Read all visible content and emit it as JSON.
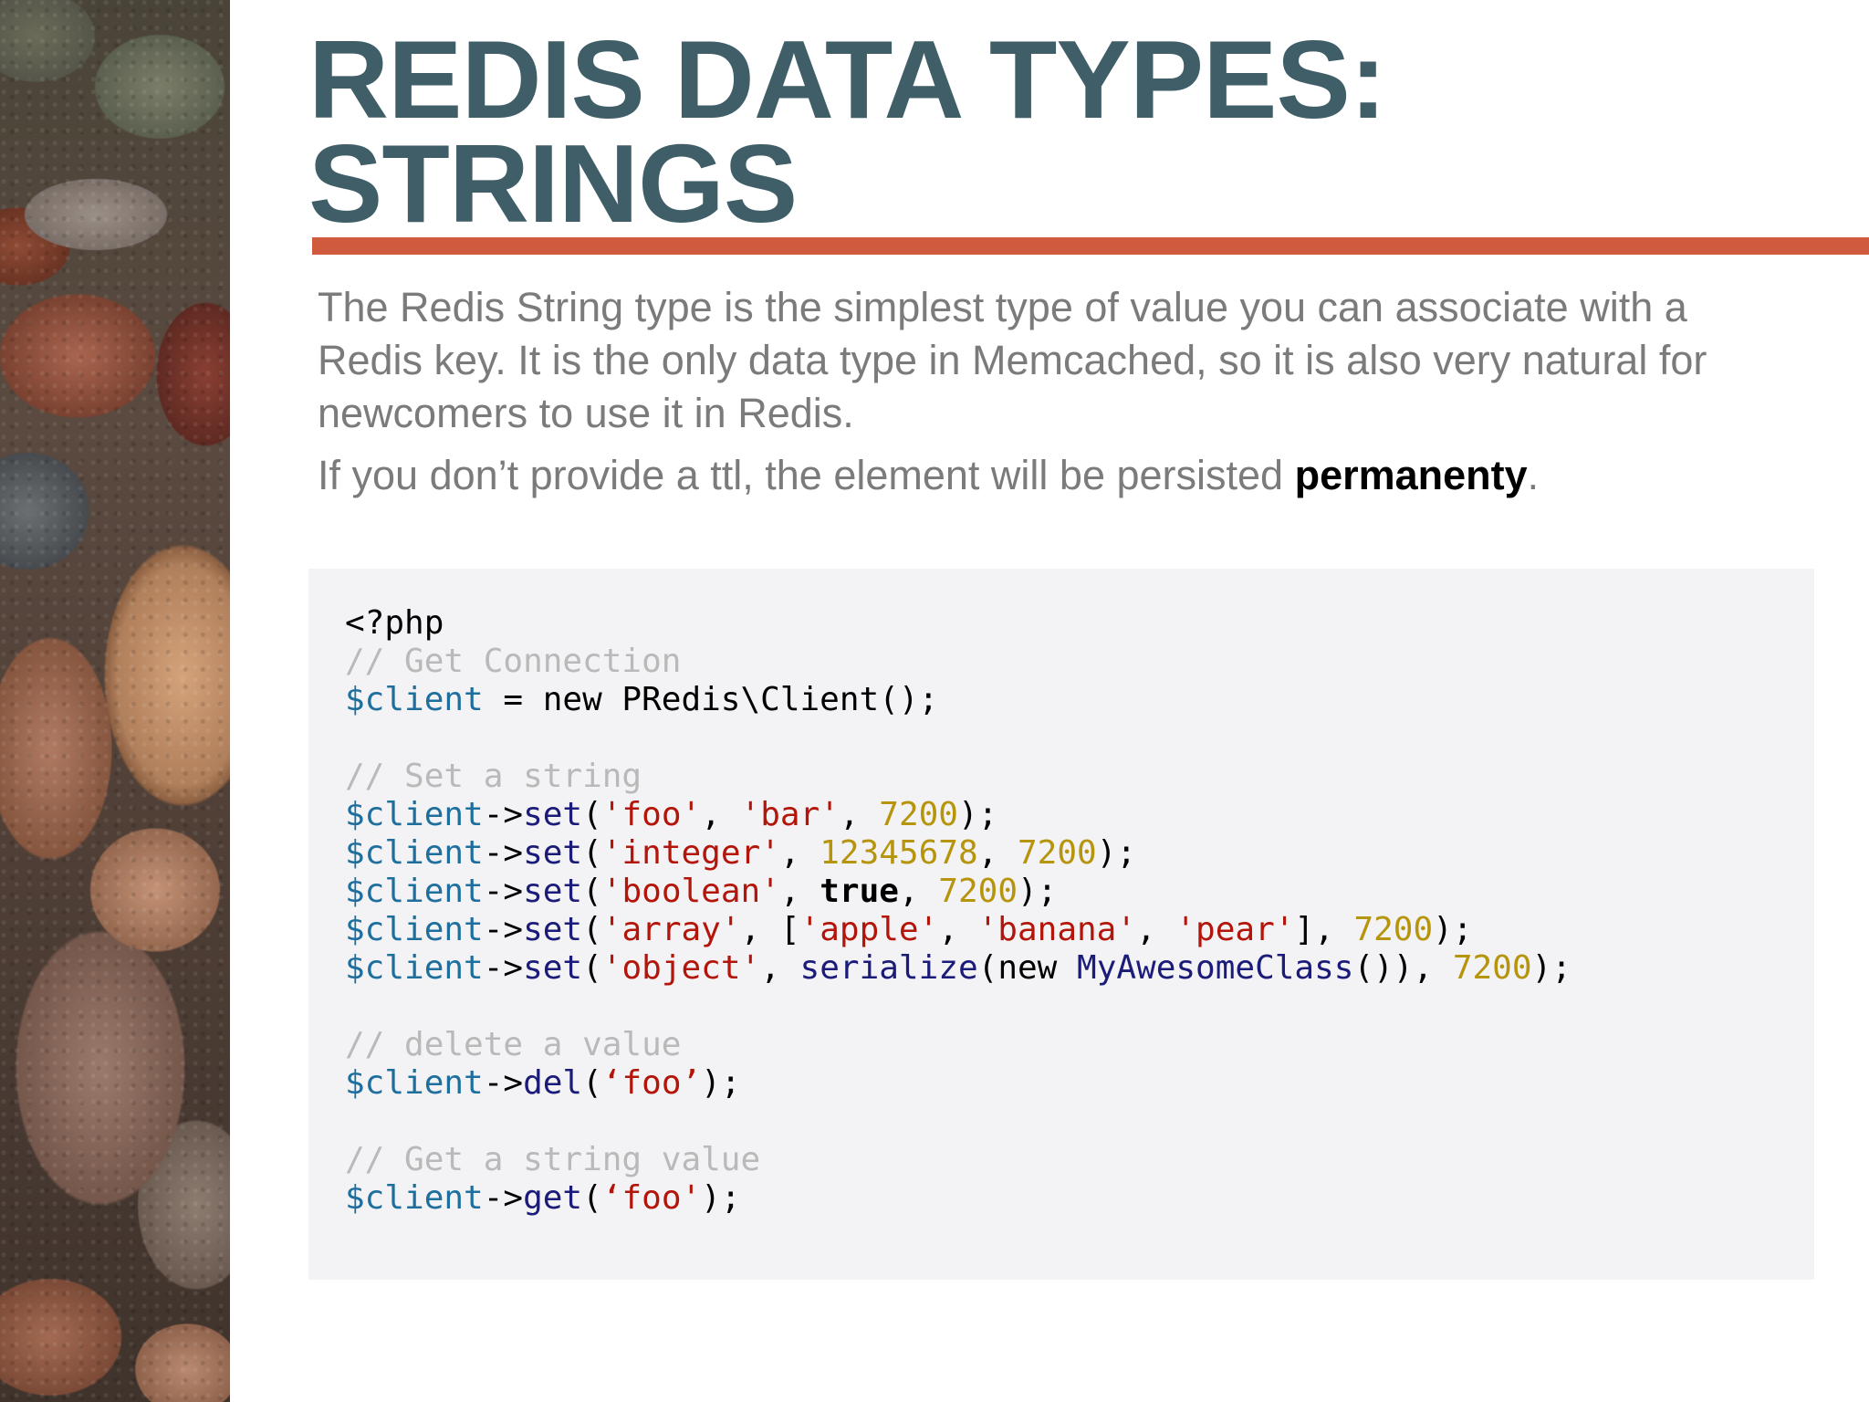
{
  "slide": {
    "title_line1": "REDIS DATA TYPES:",
    "title_line2": "STRINGS",
    "paragraph1": "The Redis String type is the simplest type of value you can associate with a Redis key. It is the only data type in Memcached, so it is also very natural for newcomers to use it in Redis.",
    "paragraph2_prefix": "If you don’t provide a ttl, the element will be persisted ",
    "paragraph2_bold": "permanenty",
    "paragraph2_suffix": "."
  },
  "code": {
    "open_tag": "<?php",
    "comment_connection": "// Get Connection",
    "comment_set": "// Set a string",
    "comment_delete": "// delete a value",
    "comment_get": "// Get a string value",
    "var_client": "$client",
    "op_assign": " = new PRedis\\Client();",
    "arrow": "->",
    "fn_set": "set",
    "fn_del": "del",
    "fn_get": "get",
    "fn_serialize": "serialize",
    "kw_new": "new ",
    "cls_name": "MyAwesomeClass",
    "kw_true": "true",
    "str_foo": "'foo'",
    "str_bar": "'bar'",
    "str_integer": "'integer'",
    "str_boolean": "'boolean'",
    "str_array": "'array'",
    "str_apple": "'apple'",
    "str_banana": "'banana'",
    "str_pear": "'pear'",
    "str_object": "'object'",
    "str_foo_curly_del": "‘foo’",
    "str_foo_get": "‘foo'",
    "num_7200": "7200",
    "num_12345678": "12345678"
  },
  "decor": {
    "sidebar_image": "pebbles-photo",
    "accent_color": "#cf5a3e",
    "title_color": "#3f5e68"
  }
}
